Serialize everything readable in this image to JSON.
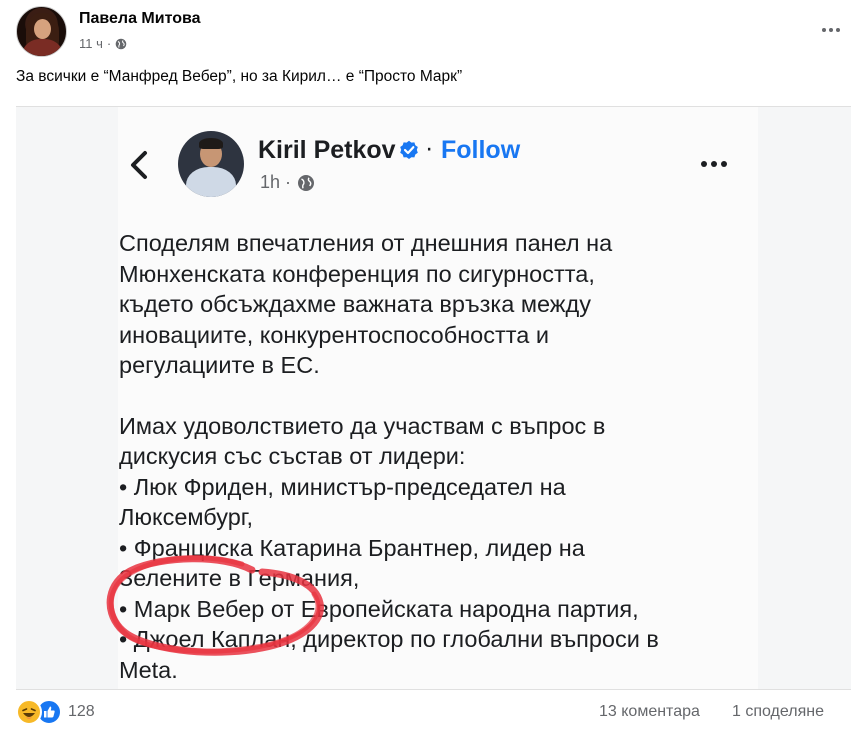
{
  "post": {
    "author": "Павела Митова",
    "time": "11 ч",
    "audience_icon": "globe-icon",
    "text": "За всички е “Манфред Вебер”, но за Кирил… е “Просто Марк”"
  },
  "embedded": {
    "name": "Kiril Petkov",
    "verified_icon": "verified-badge-icon",
    "separator": "·",
    "follow_label": "Follow",
    "time": "1h ·",
    "paragraph1": [
      "Споделям впечатления от днешния панел на",
      "Мюнхенската конференция по сигурността,",
      "където обсъждахме важната връзка между",
      "иновациите, конкурентоспособността и",
      "регулациите в ЕС."
    ],
    "paragraph2": [
      "Имах удоволствието да участвам с въпрос в",
      "дискусия със състав от лидери:",
      "• Люк Фриден, министър-председател на",
      "Люксембург,",
      "• Франциска Катарина Брантнер, лидер на",
      "Зелените в Германия,",
      "• Марк Вебер от Европейската народна партия,",
      "• Джоел Каплан, директор по глобални въпроси в",
      "Meta."
    ],
    "highlight_color": "#e8333f"
  },
  "footer": {
    "reaction_count": "128",
    "comments": "13 коментара",
    "shares": "1 споделяне"
  },
  "colors": {
    "accent": "#1877f2",
    "secondary_text": "#65676b"
  }
}
